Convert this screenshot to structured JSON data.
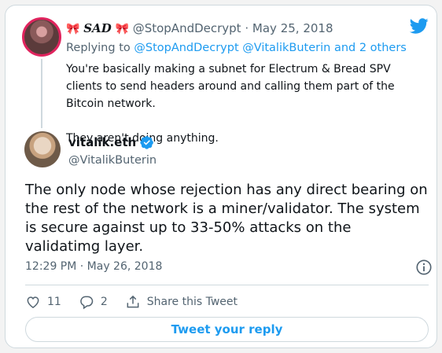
{
  "quoted_tweet": {
    "bow_left": "🎀",
    "display_name": "𝑺𝑨𝑫",
    "bow_right": "🎀",
    "handle": "@StopAndDecrypt",
    "separator": "·",
    "date": "May 25, 2018",
    "replying_prefix": "Replying to",
    "replying_handles": "@StopAndDecrypt @VitalikButerin",
    "replying_suffix": "and 2 others",
    "text_p1": "You're basically making a subnet for Electrum & Bread SPV clients to send headers around and calling them part of the Bitcoin network.",
    "text_p2": "They aren't doing anything."
  },
  "tweet": {
    "display_name": "vitalik.eth",
    "handle": "@VitalikButerin",
    "text": "The only node whose rejection has any direct bearing on the rest of the network is a miner/validator. The system is secure against up to 33-50% attacks on the validatimg layer.",
    "timestamp": "12:29 PM · May 26, 2018"
  },
  "actions": {
    "like_count": "11",
    "reply_count": "2",
    "share_label": "Share this Tweet"
  },
  "reply_button_label": "Tweet your reply",
  "colors": {
    "accent": "#1d9bf0",
    "muted": "#536471",
    "bow": "#e0245e"
  },
  "icons": [
    "twitter-bird-icon",
    "verified-badge-icon",
    "info-icon",
    "heart-icon",
    "reply-icon",
    "share-icon"
  ]
}
